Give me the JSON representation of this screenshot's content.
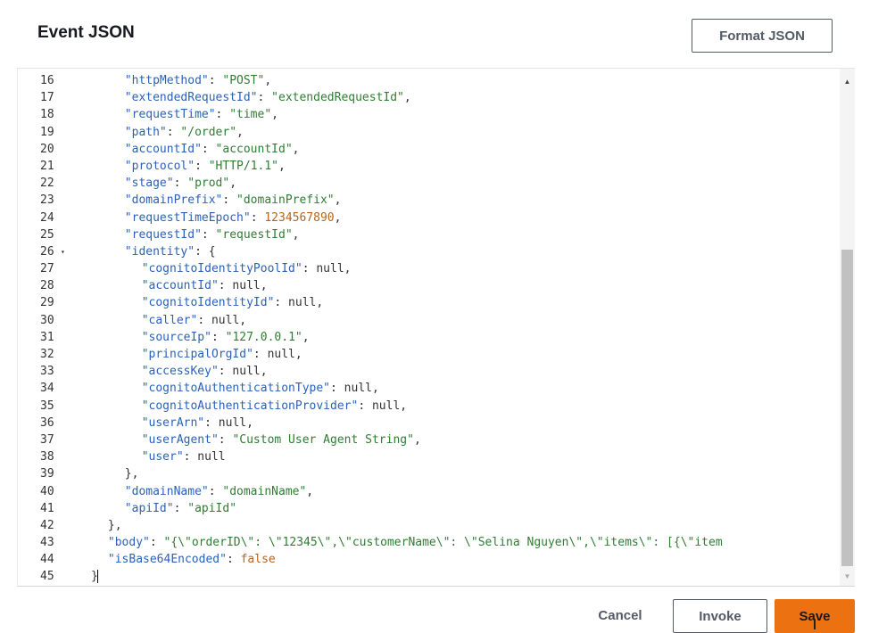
{
  "dialog": {
    "title": "Event JSON",
    "format_button": "Format JSON"
  },
  "editor": {
    "lines": [
      {
        "num": "16",
        "indent": 4,
        "tokens": [
          {
            "t": "k",
            "v": "\"httpMethod\""
          },
          {
            "t": "p",
            "v": ": "
          },
          {
            "t": "s",
            "v": "\"POST\""
          },
          {
            "t": "p",
            "v": ","
          }
        ]
      },
      {
        "num": "17",
        "indent": 4,
        "tokens": [
          {
            "t": "k",
            "v": "\"extendedRequestId\""
          },
          {
            "t": "p",
            "v": ": "
          },
          {
            "t": "s",
            "v": "\"extendedRequestId\""
          },
          {
            "t": "p",
            "v": ","
          }
        ]
      },
      {
        "num": "18",
        "indent": 4,
        "tokens": [
          {
            "t": "k",
            "v": "\"requestTime\""
          },
          {
            "t": "p",
            "v": ": "
          },
          {
            "t": "s",
            "v": "\"time\""
          },
          {
            "t": "p",
            "v": ","
          }
        ]
      },
      {
        "num": "19",
        "indent": 4,
        "tokens": [
          {
            "t": "k",
            "v": "\"path\""
          },
          {
            "t": "p",
            "v": ": "
          },
          {
            "t": "s",
            "v": "\"/order\""
          },
          {
            "t": "p",
            "v": ","
          }
        ]
      },
      {
        "num": "20",
        "indent": 4,
        "tokens": [
          {
            "t": "k",
            "v": "\"accountId\""
          },
          {
            "t": "p",
            "v": ": "
          },
          {
            "t": "s",
            "v": "\"accountId\""
          },
          {
            "t": "p",
            "v": ","
          }
        ]
      },
      {
        "num": "21",
        "indent": 4,
        "tokens": [
          {
            "t": "k",
            "v": "\"protocol\""
          },
          {
            "t": "p",
            "v": ": "
          },
          {
            "t": "s",
            "v": "\"HTTP/1.1\""
          },
          {
            "t": "p",
            "v": ","
          }
        ]
      },
      {
        "num": "22",
        "indent": 4,
        "tokens": [
          {
            "t": "k",
            "v": "\"stage\""
          },
          {
            "t": "p",
            "v": ": "
          },
          {
            "t": "s",
            "v": "\"prod\""
          },
          {
            "t": "p",
            "v": ","
          }
        ]
      },
      {
        "num": "23",
        "indent": 4,
        "tokens": [
          {
            "t": "k",
            "v": "\"domainPrefix\""
          },
          {
            "t": "p",
            "v": ": "
          },
          {
            "t": "s",
            "v": "\"domainPrefix\""
          },
          {
            "t": "p",
            "v": ","
          }
        ]
      },
      {
        "num": "24",
        "indent": 4,
        "tokens": [
          {
            "t": "k",
            "v": "\"requestTimeEpoch\""
          },
          {
            "t": "p",
            "v": ": "
          },
          {
            "t": "n",
            "v": "1234567890"
          },
          {
            "t": "p",
            "v": ","
          }
        ]
      },
      {
        "num": "25",
        "indent": 4,
        "tokens": [
          {
            "t": "k",
            "v": "\"requestId\""
          },
          {
            "t": "p",
            "v": ": "
          },
          {
            "t": "s",
            "v": "\"requestId\""
          },
          {
            "t": "p",
            "v": ","
          }
        ]
      },
      {
        "num": "26",
        "indent": 4,
        "fold": "▾",
        "tokens": [
          {
            "t": "k",
            "v": "\"identity\""
          },
          {
            "t": "p",
            "v": ": {"
          }
        ]
      },
      {
        "num": "27",
        "indent": 6,
        "tokens": [
          {
            "t": "k",
            "v": "\"cognitoIdentityPoolId\""
          },
          {
            "t": "p",
            "v": ": null,"
          }
        ]
      },
      {
        "num": "28",
        "indent": 6,
        "tokens": [
          {
            "t": "k",
            "v": "\"accountId\""
          },
          {
            "t": "p",
            "v": ": null,"
          }
        ]
      },
      {
        "num": "29",
        "indent": 6,
        "tokens": [
          {
            "t": "k",
            "v": "\"cognitoIdentityId\""
          },
          {
            "t": "p",
            "v": ": null,"
          }
        ]
      },
      {
        "num": "30",
        "indent": 6,
        "tokens": [
          {
            "t": "k",
            "v": "\"caller\""
          },
          {
            "t": "p",
            "v": ": null,"
          }
        ]
      },
      {
        "num": "31",
        "indent": 6,
        "tokens": [
          {
            "t": "k",
            "v": "\"sourceIp\""
          },
          {
            "t": "p",
            "v": ": "
          },
          {
            "t": "s",
            "v": "\"127.0.0.1\""
          },
          {
            "t": "p",
            "v": ","
          }
        ]
      },
      {
        "num": "32",
        "indent": 6,
        "tokens": [
          {
            "t": "k",
            "v": "\"principalOrgId\""
          },
          {
            "t": "p",
            "v": ": null,"
          }
        ]
      },
      {
        "num": "33",
        "indent": 6,
        "tokens": [
          {
            "t": "k",
            "v": "\"accessKey\""
          },
          {
            "t": "p",
            "v": ": null,"
          }
        ]
      },
      {
        "num": "34",
        "indent": 6,
        "tokens": [
          {
            "t": "k",
            "v": "\"cognitoAuthenticationType\""
          },
          {
            "t": "p",
            "v": ": null,"
          }
        ]
      },
      {
        "num": "35",
        "indent": 6,
        "tokens": [
          {
            "t": "k",
            "v": "\"cognitoAuthenticationProvider\""
          },
          {
            "t": "p",
            "v": ": null,"
          }
        ]
      },
      {
        "num": "36",
        "indent": 6,
        "tokens": [
          {
            "t": "k",
            "v": "\"userArn\""
          },
          {
            "t": "p",
            "v": ": null,"
          }
        ]
      },
      {
        "num": "37",
        "indent": 6,
        "tokens": [
          {
            "t": "k",
            "v": "\"userAgent\""
          },
          {
            "t": "p",
            "v": ": "
          },
          {
            "t": "s",
            "v": "\"Custom User Agent String\""
          },
          {
            "t": "p",
            "v": ","
          }
        ]
      },
      {
        "num": "38",
        "indent": 6,
        "tokens": [
          {
            "t": "k",
            "v": "\"user\""
          },
          {
            "t": "p",
            "v": ": null"
          }
        ]
      },
      {
        "num": "39",
        "indent": 4,
        "tokens": [
          {
            "t": "p",
            "v": "},"
          }
        ]
      },
      {
        "num": "40",
        "indent": 4,
        "tokens": [
          {
            "t": "k",
            "v": "\"domainName\""
          },
          {
            "t": "p",
            "v": ": "
          },
          {
            "t": "s",
            "v": "\"domainName\""
          },
          {
            "t": "p",
            "v": ","
          }
        ]
      },
      {
        "num": "41",
        "indent": 4,
        "tokens": [
          {
            "t": "k",
            "v": "\"apiId\""
          },
          {
            "t": "p",
            "v": ": "
          },
          {
            "t": "s",
            "v": "\"apiId\""
          }
        ]
      },
      {
        "num": "42",
        "indent": 2,
        "tokens": [
          {
            "t": "p",
            "v": "},"
          }
        ]
      },
      {
        "num": "43",
        "indent": 2,
        "tokens": [
          {
            "t": "k",
            "v": "\"body\""
          },
          {
            "t": "p",
            "v": ": "
          },
          {
            "t": "s",
            "v": "\"{\\\"orderID\\\": \\\"12345\\\",\\\"customerName\\\": \\\"Selina Nguyen\\\",\\\"items\\\": [{\\\"item"
          }
        ]
      },
      {
        "num": "44",
        "indent": 2,
        "tokens": [
          {
            "t": "k",
            "v": "\"isBase64Encoded\""
          },
          {
            "t": "p",
            "v": ": "
          },
          {
            "t": "b",
            "v": "false"
          }
        ]
      },
      {
        "num": "45",
        "indent": 0,
        "cursor": true,
        "tokens": [
          {
            "t": "p",
            "v": "}"
          }
        ]
      }
    ]
  },
  "footer": {
    "cancel_label": "Cancel",
    "invoke_label": "Invoke",
    "save_label": "Save"
  },
  "colors": {
    "accent": "#ec7211",
    "json_key": "#2b62b8",
    "json_string": "#2f7d32",
    "json_number": "#b5651d"
  }
}
